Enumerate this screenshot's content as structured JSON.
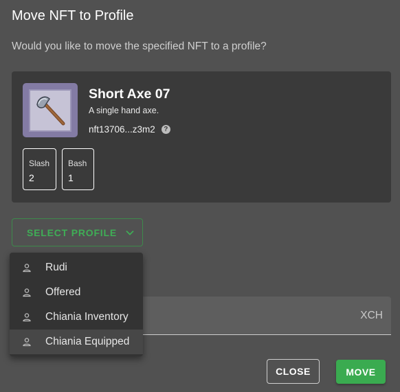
{
  "dialog": {
    "title": "Move NFT to Profile",
    "description": "Would you like to move the specified NFT to a profile?"
  },
  "nft": {
    "name": "Short Axe 07",
    "description": "A single hand axe.",
    "id": "nft13706...z3m2",
    "image_icon": "axe-icon",
    "attributes": [
      {
        "name": "Slash",
        "value": "2"
      },
      {
        "name": "Bash",
        "value": "1"
      }
    ]
  },
  "select_profile": {
    "label": "SELECT PROFILE",
    "icon": "chevron-down-icon"
  },
  "profile_menu": {
    "items": [
      {
        "label": "Rudi",
        "icon": "person-icon"
      },
      {
        "label": "Offered",
        "icon": "person-icon"
      },
      {
        "label": "Chiania Inventory",
        "icon": "person-icon"
      },
      {
        "label": "Chiania Equipped",
        "icon": "person-icon"
      }
    ]
  },
  "fee_field": {
    "unit": "XCH"
  },
  "actions": {
    "close_label": "CLOSE",
    "move_label": "MOVE"
  },
  "colors": {
    "background": "#515151",
    "card": "#3a3a3a",
    "accent_green": "#3aab50",
    "menu_bg": "#333333"
  }
}
